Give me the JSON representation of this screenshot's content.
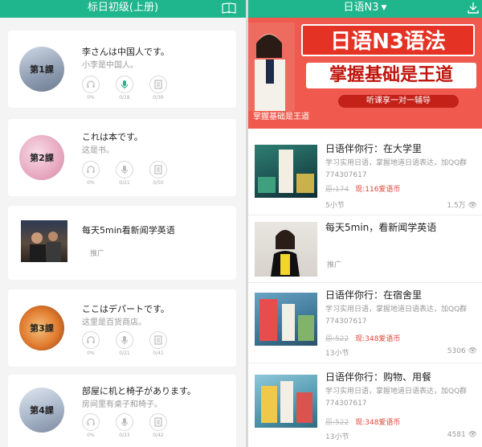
{
  "left": {
    "header_title": "标日初级(上册)",
    "lessons": [
      {
        "badge": "第1課",
        "title": "李さんは中国人です。",
        "subtitle": "小李是中国人。",
        "counts": [
          "0%",
          "0/18",
          "0/39"
        ]
      },
      {
        "badge": "第2課",
        "title": "これは本です。",
        "subtitle": "这是书。",
        "counts": [
          "0%",
          "0/21",
          "0/50"
        ]
      },
      {
        "badge": "第3課",
        "title": "ここはデパートです。",
        "subtitle": "这里是百货商店。",
        "counts": [
          "0%",
          "0/21",
          "0/41"
        ]
      },
      {
        "badge": "第4課",
        "title": "部屋に机と椅子があります。",
        "subtitle": "房间里有桌子和椅子。",
        "counts": [
          "0%",
          "0/23",
          "0/42"
        ]
      }
    ],
    "ad": {
      "title": "每天5min看新闻学英语",
      "tag": "推广"
    }
  },
  "right": {
    "header_title": "日语N3",
    "banner": {
      "line1": "日语N3语法",
      "line2": "掌握基础是王道",
      "line3": "听课享一对一辅导",
      "caption": "掌握基础是王道"
    },
    "courses": [
      {
        "title": "日语伴你行：在大学里",
        "desc": "学习实用日语，掌握地道日语表达，加QQ群774307617",
        "old_price": "原:174",
        "new_price": "现:116爱语币",
        "sections": "5小节",
        "views": "1.5万"
      },
      {
        "title": "日语伴你行：在宿舍里",
        "desc": "学习实用日语，掌握地道日语表达，加QQ群774307617",
        "old_price": "原:522",
        "new_price": "现:348爱语币",
        "sections": "13小节",
        "views": "5306"
      },
      {
        "title": "日语伴你行：购物、用餐",
        "desc": "学习实用日语，掌握地道日语表达，加QQ群774307617",
        "old_price": "原:522",
        "new_price": "现:348爱语币",
        "sections": "13小节",
        "views": "4581"
      }
    ],
    "ad": {
      "title": "每天5min，看新闻学英语",
      "tag": "推广"
    }
  },
  "colors": {
    "header": "#1fb58d",
    "banner": "#f05a4e",
    "price": "#e2463a"
  },
  "icons": [
    "book-icon",
    "headphones-icon",
    "microphone-icon",
    "document-icon",
    "eye-icon",
    "download-icon",
    "caret-down-icon"
  ]
}
